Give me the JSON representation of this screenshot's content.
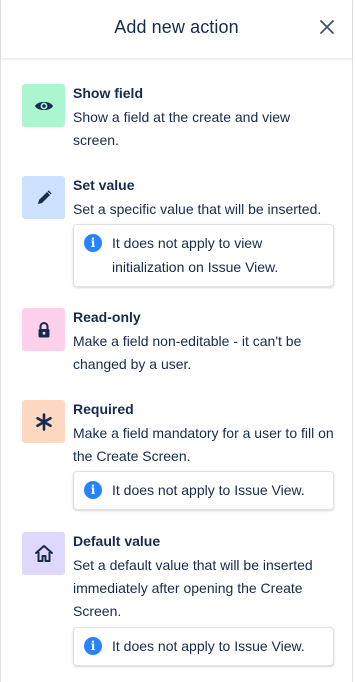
{
  "header": {
    "title": "Add new action",
    "close_icon": "close-icon"
  },
  "actions": [
    {
      "title": "Show field",
      "description": "Show a field at the create and view screen.",
      "icon": "eye-icon",
      "tile_color": "#abf5d1"
    },
    {
      "title": "Set value",
      "description": "Set a specific value that will be inserted.",
      "icon": "pencil-icon",
      "tile_color": "#cce0ff",
      "note": "It does not apply to view initialization on Issue View."
    },
    {
      "title": "Read-only",
      "description": "Make a field non-editable - it can't be changed by a user.",
      "icon": "lock-icon",
      "tile_color": "#fdd0ec"
    },
    {
      "title": "Required",
      "description": "Make a field mandatory for a user to fill on the Create Screen.",
      "icon": "asterisk-icon",
      "tile_color": "#ffd8c2",
      "note": "It does not apply to Issue View."
    },
    {
      "title": "Default value",
      "description": "Set a default value that will be inserted immediately after opening the Create Screen.",
      "icon": "home-icon",
      "tile_color": "#dfd8fd",
      "note": "It does not apply to Issue View."
    }
  ],
  "info_icon_glyph": "i"
}
